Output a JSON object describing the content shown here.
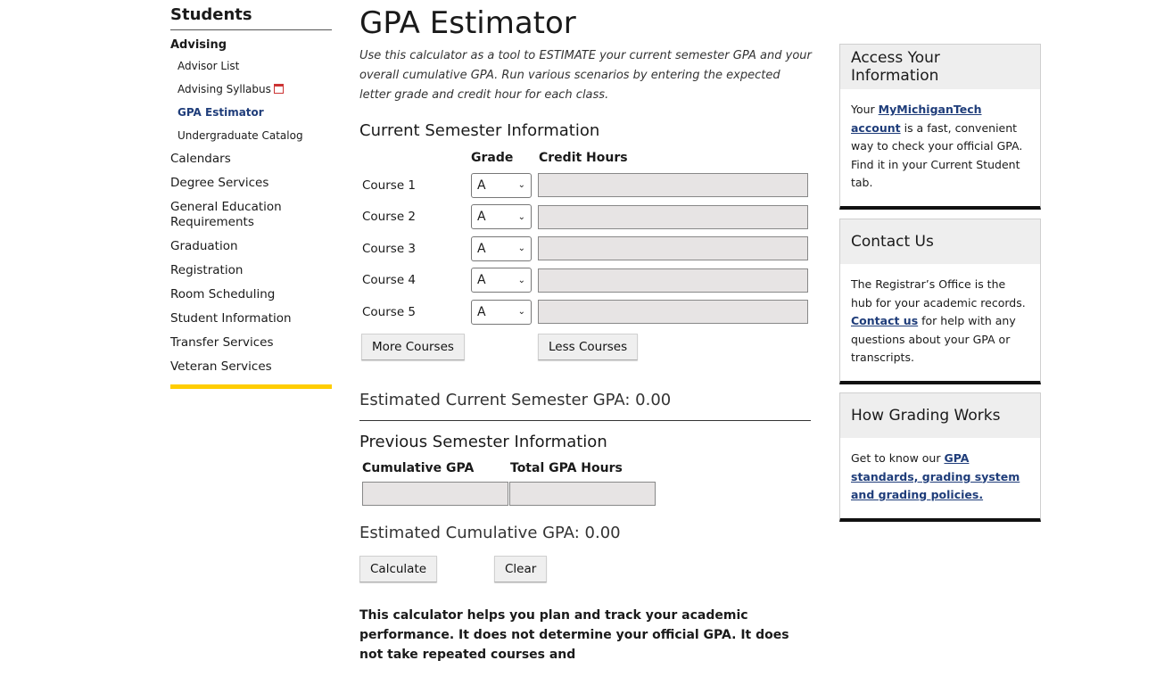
{
  "sidebar": {
    "title": "Students",
    "section": "Advising",
    "sub_items": [
      {
        "label": "Advisor List",
        "active": false,
        "pdf": false
      },
      {
        "label": "Advising Syllabus",
        "active": false,
        "pdf": true
      },
      {
        "label": "GPA Estimator",
        "active": true,
        "pdf": false
      },
      {
        "label": "Undergraduate Catalog",
        "active": false,
        "pdf": false
      }
    ],
    "items": [
      "Calendars",
      "Degree Services",
      "General Education Requirements",
      "Graduation",
      "Registration",
      "Room Scheduling",
      "Student Information",
      "Transfer Services",
      "Veteran Services"
    ]
  },
  "main": {
    "title": "GPA Estimator",
    "intro": "Use this calculator as a tool to ESTIMATE your current semester GPA and your overall cumulative GPA. Run various scenarios by entering the expected letter grade and credit hour for each class.",
    "current_heading": "Current Semester Information",
    "grade_header": "Grade",
    "hours_header": "Credit Hours",
    "courses": [
      {
        "label": "Course 1",
        "grade": "A",
        "hours": ""
      },
      {
        "label": "Course 2",
        "grade": "A",
        "hours": ""
      },
      {
        "label": "Course 3",
        "grade": "A",
        "hours": ""
      },
      {
        "label": "Course 4",
        "grade": "A",
        "hours": ""
      },
      {
        "label": "Course 5",
        "grade": "A",
        "hours": ""
      }
    ],
    "more_courses": "More Courses",
    "less_courses": "Less Courses",
    "est_current": "Estimated Current Semester GPA: 0.00",
    "previous_heading": "Previous Semester Information",
    "cumulative_header": "Cumulative GPA",
    "total_hours_header": "Total GPA Hours",
    "est_cumulative": "Estimated Cumulative GPA: 0.00",
    "calculate": "Calculate",
    "clear": "Clear",
    "disclaimer": "This calculator helps you plan and track your academic performance. It does not determine your official GPA. It does not take repeated courses and"
  },
  "boxes": {
    "access": {
      "title": "Access Your Information",
      "pre": "Your ",
      "link": "MyMichiganTech account",
      "post": " is a fast, convenient way to check your official GPA. Find it in your Current Student tab."
    },
    "contact": {
      "title": "Contact Us",
      "pre": "The Registrar’s Office is the hub for your academic records. ",
      "link": "Contact us",
      "post": " for help with any questions about your GPA or transcripts."
    },
    "grading": {
      "title": "How Grading Works",
      "pre": "Get to know our ",
      "link": "GPA standards, grading system and grading policies."
    }
  },
  "colors": {
    "accent": "#ffcd00",
    "link": "#1f3d7a"
  },
  "icons": {
    "select_arrow": "chevron-down-icon",
    "pdf": "pdf-icon"
  }
}
